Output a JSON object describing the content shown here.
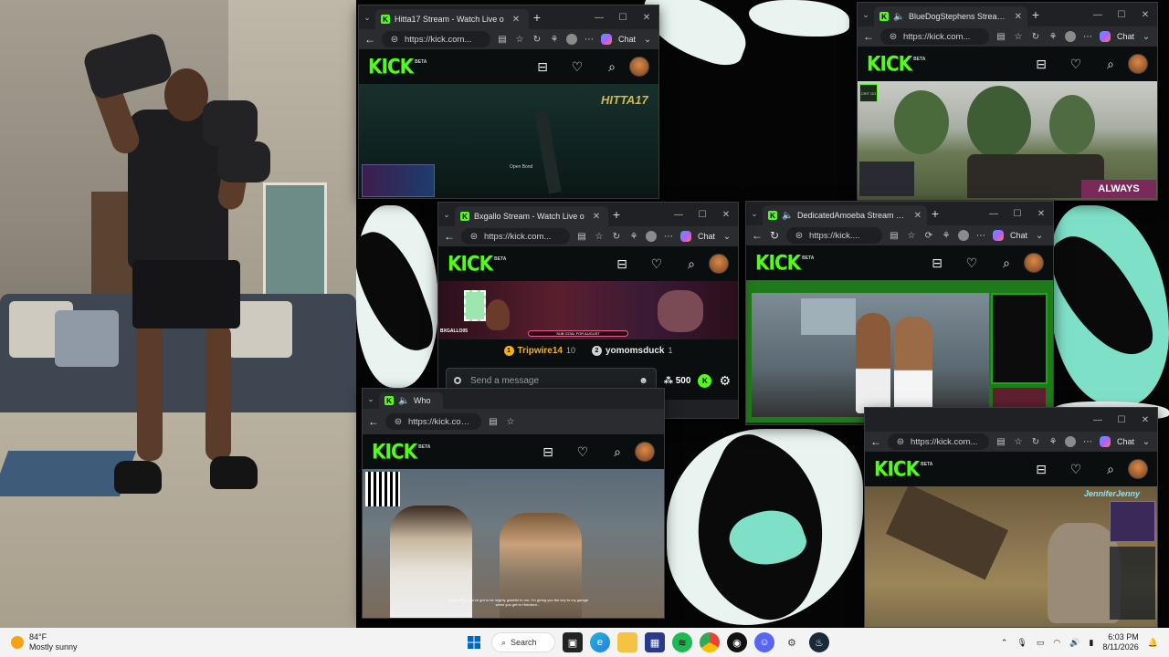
{
  "desktop": {
    "background": "#050505"
  },
  "windows": [
    {
      "id": "hitta",
      "tab_title": "Hitta17 Stream - Watch Live o",
      "url": "https://kick.com...",
      "chat_label": "Chat",
      "overlay_text": "HITTA17",
      "status_text": "Open Bond"
    },
    {
      "id": "bluedog",
      "tab_title": "BlueDogStephens Stream - W",
      "url": "https://kick.com...",
      "chat_label": "Chat",
      "badge": "ALWAYS",
      "game_badge": "CRIT GG"
    },
    {
      "id": "bxgallo",
      "tab_title": "Bxgallo Stream - Watch Live o",
      "url": "https://kick.com...",
      "chat_label": "Chat",
      "streamer_tag": "BXGALLO05",
      "goal_text": "SUB GOAL FOR AUGUST",
      "leaderboard": [
        {
          "rank": "1",
          "name": "Tripwire14",
          "value": "10"
        },
        {
          "rank": "2",
          "name": "yomomsduck",
          "value": "1"
        }
      ],
      "send_placeholder": "Send a message",
      "points": "500"
    },
    {
      "id": "amoeba",
      "tab_title": "DedicatedAmoeba Stream - W",
      "url": "https://kick....",
      "chat_label": "Chat"
    },
    {
      "id": "who",
      "tab_title": "Who",
      "url": "https://kick.com...",
      "chat_label": "Chat",
      "subtitle": "Lucas: Well, you've got to be mighty grateful to me, I'm giving you the key to my garage when you get to Hoboken..."
    },
    {
      "id": "jennifer",
      "url": "https://kick.com...",
      "chat_label": "Chat",
      "overlay_name": "JenniferJenny"
    }
  ],
  "kick": {
    "logo": "KICK",
    "beta": "BETA"
  },
  "taskbar": {
    "weather_temp": "84°F",
    "weather_desc": "Mostly sunny",
    "search_label": "Search",
    "time": "6:03 PM",
    "date": "8/11/2026",
    "accent": "#0067c0"
  },
  "colors": {
    "kick_green": "#53fc18",
    "browser_bg": "#202124"
  }
}
